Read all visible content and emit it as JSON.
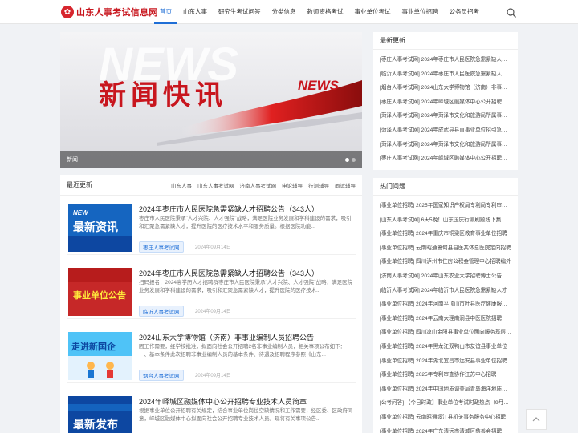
{
  "header": {
    "logo_mark": "✿",
    "logo_text": "山东人事考试信息网",
    "nav": [
      {
        "label": "首页",
        "active": true
      },
      {
        "label": "山东人事"
      },
      {
        "label": "研究生考试问答"
      },
      {
        "label": "分类信息"
      },
      {
        "label": "教师资格考试"
      },
      {
        "label": "事业单位考试"
      },
      {
        "label": "事业单位招聘"
      },
      {
        "label": "公务员招考"
      }
    ],
    "search_icon": "search-icon"
  },
  "banner": {
    "title": "新闻快讯",
    "news_word": "NEWS",
    "caption": "新闻",
    "dots": 2,
    "active_dot": 0
  },
  "latest": {
    "title": "最近更新",
    "tabs": [
      "山东人事",
      "山东人事考试网",
      "济南人事考试网",
      "申论辅导",
      "行测辅导",
      "面试辅导"
    ],
    "articles": [
      {
        "thumb_text": "最新资讯",
        "thumb_small": "NEW",
        "title": "2024年枣庄市人民医院急需紧缺人才招聘公告（343人）",
        "summary": "枣庄市人民医院秉承\"人才兴院、人才强院\"战略，满足医院业务发展和学科建设的需求，吸引和汇聚急需紧缺人才，提升医院的医疗技术水平和服务质量。根据医院功能...",
        "tag": "枣庄人事考试网",
        "date": "2024年09月14日"
      },
      {
        "thumb_text": "事业单位公告",
        "title": "2024年枣庄市人民医院急需紧缺人才招聘公告（343人）",
        "summary": "扫码报名：2024高学历人才招聘群枣庄市人民医院秉承\"人才兴院、人才强院\"战略，满足医院业务发展和学科建设的需求，吸引和汇聚急需紧缺人才，提升医院的医疗技术...",
        "tag": "临沂人事考试网",
        "date": "2024年09月14日"
      },
      {
        "thumb_text": "走进新国企",
        "title": "2024山东大学博物馆（济南）非事业编制人员招聘公告",
        "summary": "因工作需要，经学校批准，拟面向社会公开招聘2名非事业编制人员，相关事项公布如下：一、基本条件此次招聘非事业编制人员的基本条件、待遇及招聘程序参照《山东...",
        "tag": "烟台人事考试网",
        "date": "2024年09月14日"
      },
      {
        "thumb_text": "最新发布",
        "title": "2024年峄城区融媒体中心公开招聘专业技术人员简章",
        "summary": "根据事业单位公开招聘有关规定，结合事业单位岗位空缺情况和工作需要，经区委、区政府同意，峄城区融媒体中心拟面向社会公开招聘专业技术人员。现将有关事项公告...",
        "tag": "",
        "date": ""
      }
    ]
  },
  "sidebar": {
    "recent_title": "最新更新",
    "recent": [
      "[枣庄人事考试网] 2024年枣庄市人民医院急需紧缺人才招聘公告",
      "[临沂人事考试网] 2024年枣庄市人民医院急需紧缺人才招聘公告",
      "[烟台人事考试网] 2024山东大学博物馆（济南）非事业编制人员招聘",
      "[枣庄人事考试网] 2024年峄城区融媒体中心公开招聘专业技术人员",
      "[菏泽人事考试网] 2024年菏泽市文化和旅游局所属事业单位招聘",
      "[菏泽人事考试网] 2024年成武县县直事业单位招引急需紧缺人才",
      "[菏泽人事考试网] 2024年菏泽市文化和旅游局所属事业单位招聘",
      "[枣庄人事考试网] 2024年峄城区融媒体中心公开招聘专业技术人员"
    ],
    "hot_title": "热门问题",
    "hot": [
      "[事业单位招聘] 2025年国家知识产权局专利局专利审查协作",
      "[山东人事考试网] 6天5晚！山东国庆行测刷题线下集训营",
      "[事业单位招聘] 2024年重庆市铜梁区教育事业单位招聘",
      "[事业单位招聘] 云南昭通鲁甸县县医共体总医院定向招聘",
      "[事业单位招聘] 四川泸州市住房公积金管理中心招聘编外",
      "[济南人事考试网] 2024年山东农业大学招聘博士公告",
      "[临沂人事考试网] 2024年临沂市人民医院急需紧缺人才",
      "[事业单位招聘] 2024年河南平顶山市叶县医疗健康服务集团",
      "[事业单位招聘] 2024年云南大理南涧县中医医院招聘",
      "[事业单位招聘] 四川凉山金阳县事业单位面向服务基层项目",
      "[事业单位招聘] 2024年黑龙江双鸭山市友谊县事业单位",
      "[事业单位招聘] 2024年湖北宜昌市远安县事业单位招聘",
      "[事业单位招聘] 2025年专利审查协作江苏中心招聘",
      "[事业单位招聘] 2024年中国地质调查局青岛海洋地质研究所",
      "[公考问答] 【今日时政】事业单位考试时政热点（9月13日）",
      "[事业单位招聘] 云南昭通绥江县机关事务服务中心招聘",
      "[事业单位招聘] 2024年广东清远市清城区慈善会招聘"
    ]
  },
  "colors": {
    "accent": "#1e6ed6",
    "brand_red": "#c8161e"
  }
}
